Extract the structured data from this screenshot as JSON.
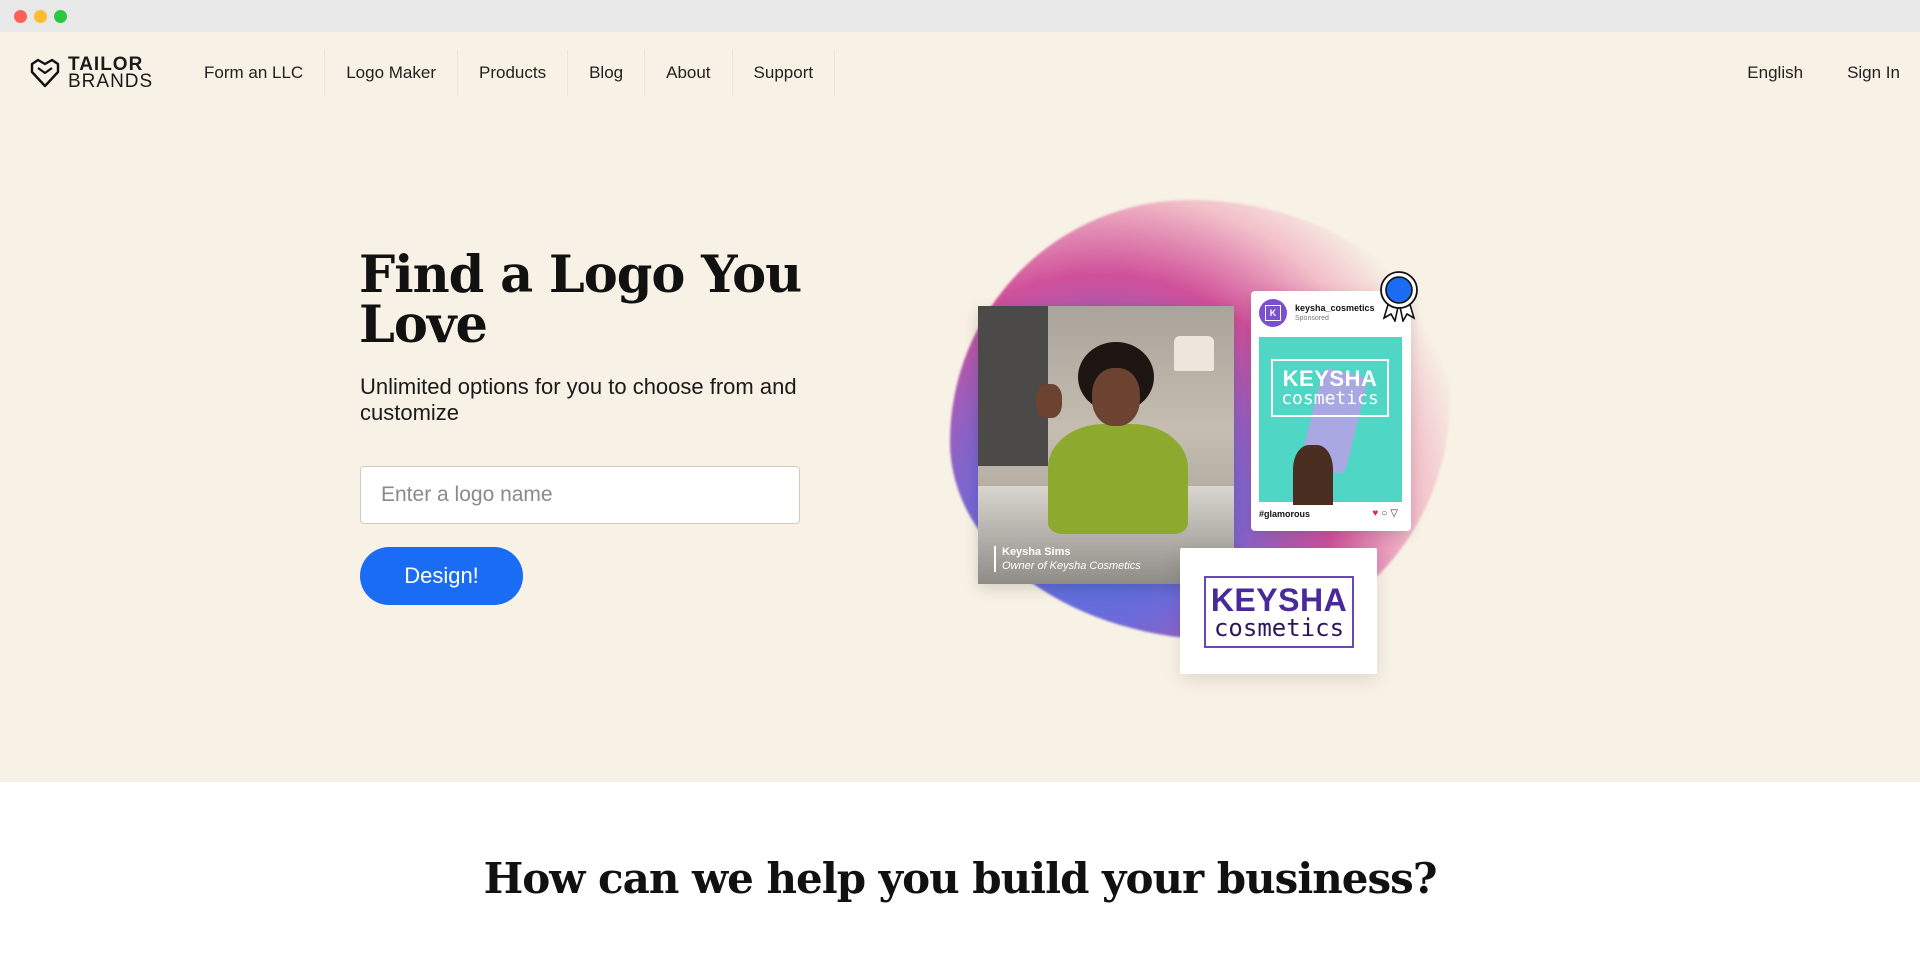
{
  "brand": {
    "line1": "TAILOR",
    "line2": "BRANDS"
  },
  "nav": {
    "items": [
      {
        "label": "Form an LLC"
      },
      {
        "label": "Logo Maker"
      },
      {
        "label": "Products"
      },
      {
        "label": "Blog"
      },
      {
        "label": "About"
      },
      {
        "label": "Support"
      }
    ],
    "language": "English",
    "sign_in": "Sign In"
  },
  "hero": {
    "title": "Find a Logo You Love",
    "subtitle": "Unlimited options for you to choose from and customize",
    "input_placeholder": "Enter a logo name",
    "cta": "Design!"
  },
  "illustration": {
    "photo_name": "Keysha Sims",
    "photo_role": "Owner of Keysha Cosmetics",
    "post_handle": "keysha_cosmetics",
    "post_sponsored": "Sponsored",
    "post_avatar": "K",
    "post_brand_line1": "KEYSHA",
    "post_brand_line2": "cosmetics",
    "post_tag": "#glamorous",
    "logo_line1": "KEYSHA",
    "logo_line2": "cosmetics"
  },
  "section": {
    "title": "How can we help you build your business?"
  },
  "colors": {
    "hero_bg": "#f8f1e5",
    "cta": "#1a6cf5",
    "brand_purple": "#6a46b8"
  }
}
